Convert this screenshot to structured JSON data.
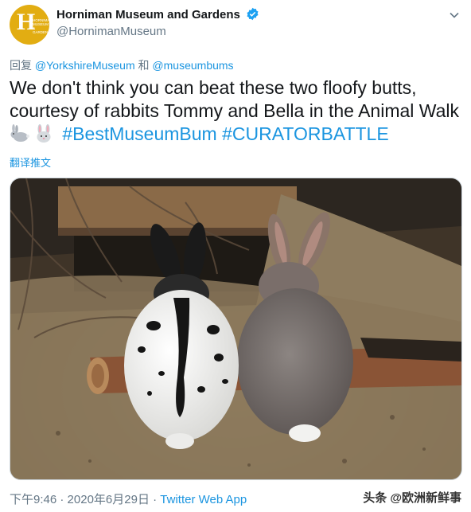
{
  "account": {
    "display_name": "Horniman Museum and Gardens",
    "handle": "@HornimanMuseum",
    "avatar_letter": "H",
    "avatar_text": "HORNIMAN MUSEUM & GARDENS"
  },
  "reply": {
    "prefix": "回复",
    "user1": "@YorkshireMuseum",
    "joiner": "和",
    "user2": "@museumbums"
  },
  "tweet": {
    "text": "We don't think you can beat these two floofy butts, courtesy of rabbits Tommy and Bella in the Animal Walk",
    "hashtag1": "#BestMuseumBum",
    "hashtag2": "#CURATORBATTLE",
    "translate_label": "翻译推文"
  },
  "footer": {
    "time": "下午9:46",
    "separator1": "·",
    "date": "2020年6月29日",
    "separator2": "·",
    "app": "Twitter Web App"
  },
  "watermark": "头条 @欧洲新鲜事",
  "colors": {
    "link": "#1b95e0",
    "secondary": "#657786",
    "avatar_bg": "#e2ad12"
  }
}
